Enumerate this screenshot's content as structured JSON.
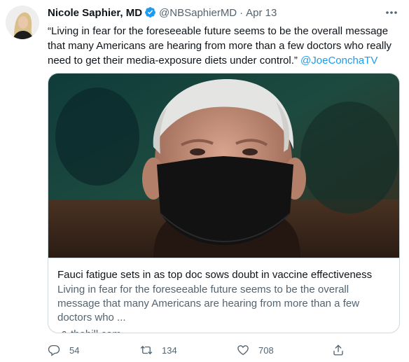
{
  "tweet": {
    "author_name": "Nicole Saphier, MD",
    "handle": "@NBSaphierMD",
    "separator": "·",
    "date": "Apr 13",
    "text_quote": "“Living in fear for the foreseeable future seems to be the overall message that many Americans are hearing from more than a few doctors who really need to get their media-exposure diets under control.”",
    "mention": "@JoeConchaTV"
  },
  "card": {
    "title": "Fauci fatigue sets in as top doc sows doubt in vaccine effectiveness",
    "description": "Living in fear for the foreseeable future seems to be the overall message that many Americans are hearing from more than a few doctors who ...",
    "domain": "thehill.com"
  },
  "actions": {
    "replies": "54",
    "retweets": "134",
    "likes": "708"
  },
  "icons": {
    "verified": "verified-badge-icon",
    "more": "more-dots-icon",
    "reply": "reply-icon",
    "retweet": "retweet-icon",
    "like": "heart-icon",
    "share": "share-icon",
    "link": "link-icon"
  },
  "colors": {
    "accent": "#1d9bf0",
    "text": "#0f1419",
    "secondary": "#536471",
    "border": "#cfd9de"
  }
}
